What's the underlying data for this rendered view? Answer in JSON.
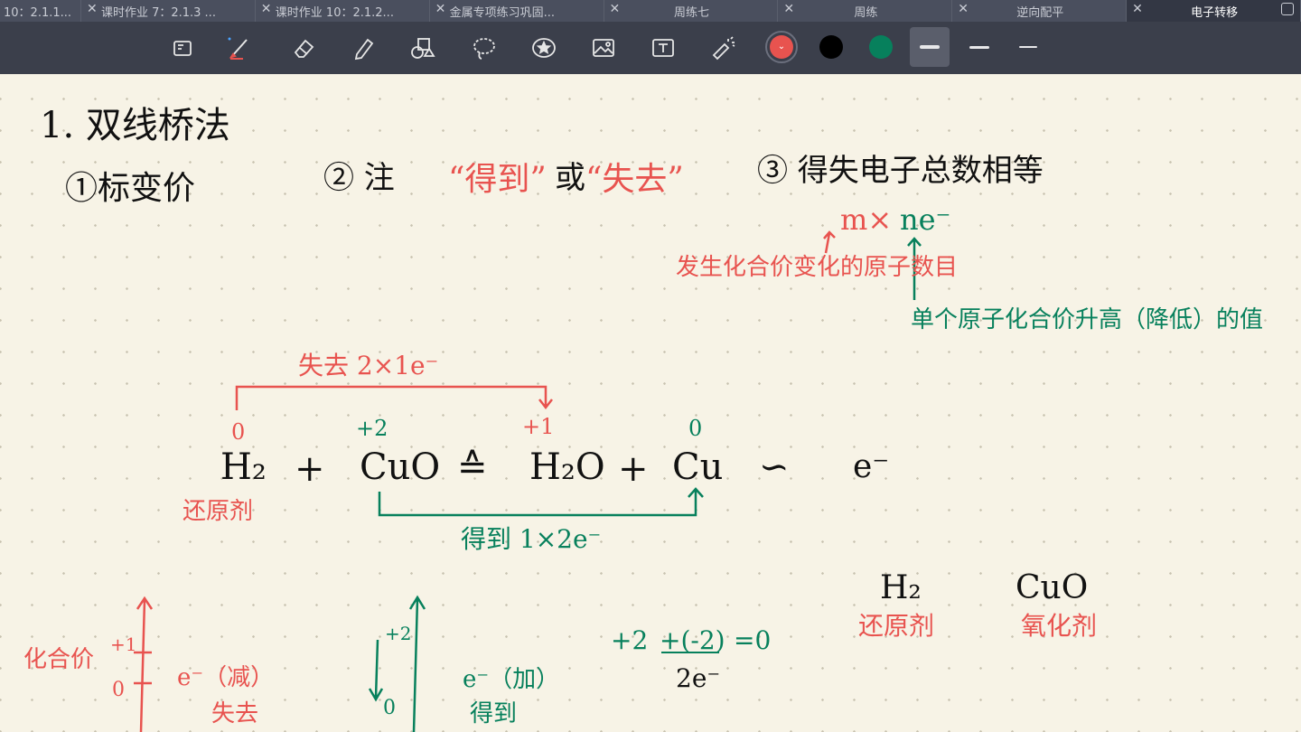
{
  "tabs": [
    {
      "label": "10：2.1.1..."
    },
    {
      "label": "课时作业 7：2.1.3 ..."
    },
    {
      "label": "课时作业 10：2.1.2..."
    },
    {
      "label": "金属专项练习巩固..."
    },
    {
      "label": "周练七"
    },
    {
      "label": "周练"
    },
    {
      "label": "逆向配平"
    },
    {
      "label": "电子转移"
    }
  ],
  "toolbar": {
    "tools": [
      "page-icon",
      "pen-icon",
      "eraser-icon",
      "highlighter-icon",
      "shapes-icon",
      "lasso-icon",
      "sticker-icon",
      "image-icon",
      "text-icon",
      "laser-pointer-icon"
    ],
    "colors": {
      "red": "#e8534f",
      "black": "#000000",
      "green": "#07805c"
    }
  },
  "note": {
    "title": "1. 双线桥法",
    "step1": "①标变价",
    "step2_prefix": "② 注",
    "step2_gain": "“得到”",
    "step2_or": "或",
    "step2_lose": "“失去”",
    "step3": "③ 得失电子总数相等",
    "formula": "m×ne⁻",
    "formula_m": "m×",
    "formula_n": "ne⁻",
    "note_m": "发生化合价变化的原子数目",
    "note_n": "单个原子化合价升高（降低）的值",
    "lose_label": "失去 2×1e⁻",
    "gain_label": "得到 1×2e⁻",
    "eq_h2": "H₂",
    "eq_plus1": "+",
    "eq_cuo": "CuO",
    "eq_arrow": "≙",
    "eq_h2o": "H₂O",
    "eq_plus2": "+",
    "eq_cu": "Cu",
    "eq_sim": "∽",
    "eq_e": "e⁻",
    "ox_h2": "0",
    "ox_cu": "+2",
    "ox_h": "+1",
    "ox_cu2": "0",
    "reducer": "还原剂",
    "r_h2": "H₂",
    "r_cuo": "CuO",
    "r_reducer": "还原剂",
    "r_oxidizer": "氧化剂",
    "axis1_label": "化合价",
    "axis1_plus1": "+1",
    "axis1_zero": "0",
    "axis1_e": "e⁻（减）",
    "axis1_lose": "失去",
    "axis2_plus2": "+2",
    "axis2_zero": "0",
    "axis2_e": "e⁻（加）",
    "axis2_gain": "得到",
    "calc_expr1": "+2",
    "calc_expr2": "+(-2)",
    "calc_expr3": "=0",
    "calc_result": "2e⁻"
  }
}
